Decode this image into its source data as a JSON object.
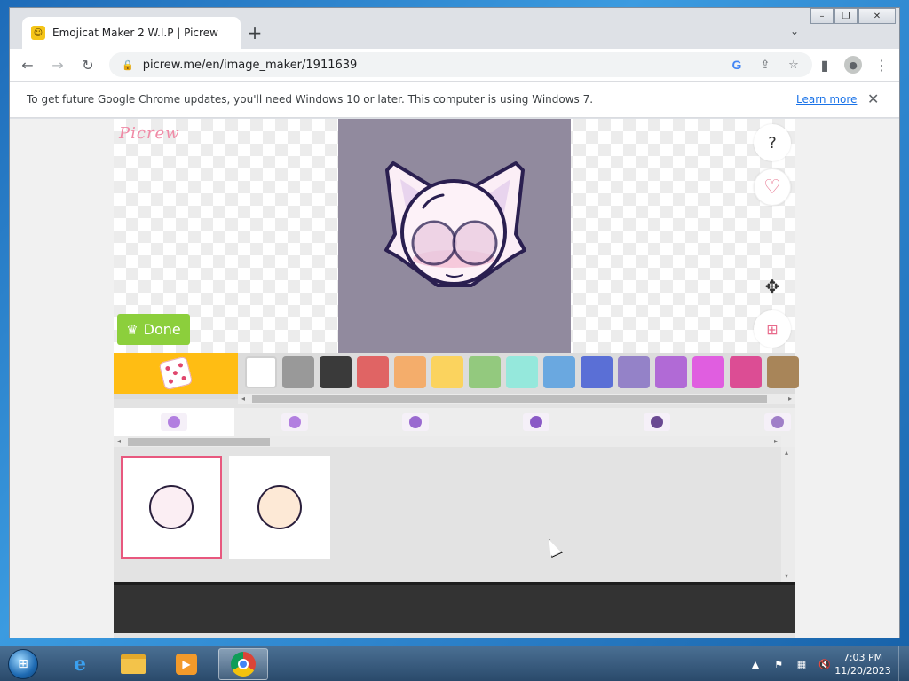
{
  "browser": {
    "tab_title": "Emojicat Maker 2 W.I.P | Picrew",
    "favicon_glyph": "☺",
    "url": "picrew.me/en/image_maker/1911639",
    "new_tab_glyph": "+",
    "tab_search_glyph": "⌄",
    "window_controls": {
      "minimize": "–",
      "restore": "❐",
      "close": "✕"
    },
    "nav": {
      "back": "←",
      "forward": "→",
      "reload": "↻"
    },
    "omnibox_icons": {
      "lock": "🔒",
      "google": "G",
      "share": "⇪",
      "bookmark": "☆"
    },
    "toolbar_icons": {
      "side_panel": "▮",
      "profile": "●",
      "menu": "⋮"
    }
  },
  "infobar": {
    "message": "To get future Google Chrome updates, you'll need Windows 10 or later. This computer is using Windows 7.",
    "learn_more": "Learn more",
    "close": "✕"
  },
  "picrew": {
    "logo": "Picrew",
    "done_label": "Done",
    "crown": "♛",
    "side_buttons": {
      "help": "?",
      "favorite": "♡",
      "move": "✥",
      "grid": "⊞"
    },
    "swatches": [
      "#ffffff",
      "#999999",
      "#3a3a3a",
      "#e06464",
      "#f4ad6b",
      "#fbd35e",
      "#93c97e",
      "#95e8dc",
      "#6aa8e0",
      "#5a6fd6",
      "#9482c8",
      "#b16ad6",
      "#e05ee0",
      "#dc4d94",
      "#a88559"
    ],
    "part_tabs": [
      {
        "color": "#b27fe0"
      },
      {
        "color": "#b27fe0"
      },
      {
        "color": "#9a6ad0"
      },
      {
        "color": "#8a5ac6"
      },
      {
        "color": "#6a4a92"
      },
      {
        "color": "#a07fc8"
      }
    ],
    "items": [
      {
        "fill": "#fbeef3",
        "selected": true
      },
      {
        "fill": "#fde9d6",
        "selected": false
      }
    ],
    "scroll_arrows": {
      "left": "◂",
      "right": "▸",
      "up": "▴",
      "down": "▾"
    }
  },
  "taskbar": {
    "start_glyph": "⊞",
    "ie_glyph": "e",
    "media_glyph": "▶",
    "tray": {
      "expand": "▲",
      "flag": "⚑",
      "network": "▦",
      "volume": "🔇"
    },
    "time": "7:03 PM",
    "date": "11/20/2023"
  }
}
